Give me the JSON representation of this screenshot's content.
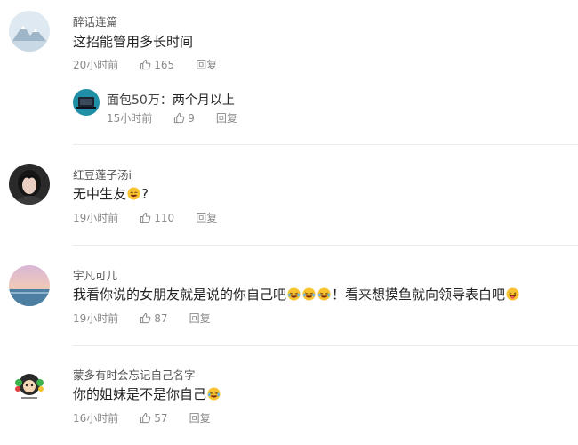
{
  "comments": [
    {
      "username": "醉话连篇",
      "text": "这招能管用多长时间",
      "time": "20小时前",
      "likes": "165",
      "reply_label": "回复",
      "sub_reply": {
        "username": "面包50万：",
        "text": "两个月以上",
        "time": "15小时前",
        "likes": "9",
        "reply_label": "回复"
      }
    },
    {
      "username": "红豆莲子汤i",
      "text_before": "无中生友",
      "text_after": "?",
      "time": "19小时前",
      "likes": "110",
      "reply_label": "回复"
    },
    {
      "username": "宇凡可儿",
      "text_before": "我看你说的女朋友就是说的你自己吧",
      "text_middle": "！看来想摸鱼就向领导表白吧",
      "time": "19小时前",
      "likes": "87",
      "reply_label": "回复"
    },
    {
      "username": "蒙多有时会忘记自己名字",
      "text_before": "你的姐妹是不是你自己",
      "time": "16小时前",
      "likes": "57",
      "reply_label": "回复"
    }
  ],
  "colors": {
    "meta": "#8a8a8a",
    "divider": "#ececec",
    "text": "#222222"
  },
  "icons": {
    "like": "thumbs-up-icon",
    "emoji_smile": "smile-emoji-icon",
    "emoji_laugh": "laugh-cry-emoji-icon"
  }
}
